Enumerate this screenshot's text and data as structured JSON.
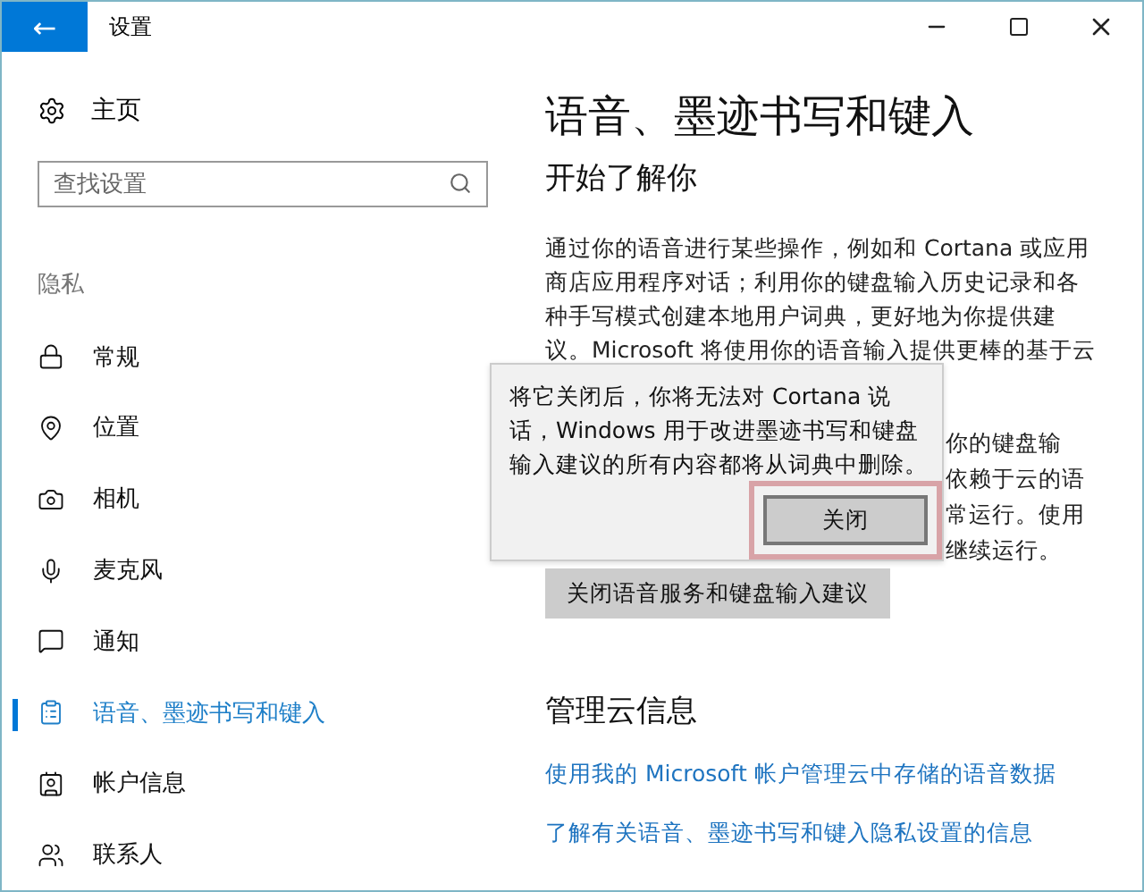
{
  "window": {
    "title": "设置",
    "back": "←"
  },
  "sidebar": {
    "home": "主页",
    "search": {
      "placeholder": "查找设置"
    },
    "section": "隐私",
    "items": [
      {
        "label": "常规",
        "selected": false
      },
      {
        "label": "位置",
        "selected": false
      },
      {
        "label": "相机",
        "selected": false
      },
      {
        "label": "麦克风",
        "selected": false
      },
      {
        "label": "通知",
        "selected": false
      },
      {
        "label": "语音、墨迹书写和键入",
        "selected": true
      },
      {
        "label": "帐户信息",
        "selected": false
      },
      {
        "label": "联系人",
        "selected": false
      }
    ]
  },
  "content": {
    "title": "语音、墨迹书写和键入",
    "subtitle": "开始了解你",
    "paragraph": [
      "通过你的语音进行某些操作，例如和 Cortana 或应用",
      "商店应用程序对话；利用你的键盘输入历史记录和各",
      "种手写模式创建本地用户词典，更好地为你提供建",
      "议。Microsoft 将使用你的语音输入提供更棒的基于云"
    ],
    "paragraph_fragments": [
      "你的键盘输",
      "依赖于云的语",
      "常运行。使用",
      "继续运行。"
    ],
    "button": "关闭语音服务和键盘输入建议",
    "section": "管理云信息",
    "links": [
      "使用我的 Microsoft 帐户管理云中存储的语音数据",
      "了解有关语音、墨迹书写和键入隐私设置的信息"
    ]
  },
  "popup": {
    "text": "将它关闭后，你将无法对 Cortana 说话，Windows 用于改进墨迹书写和键盘输入建议的所有内容都将从词典中删除。",
    "button": "关闭"
  }
}
